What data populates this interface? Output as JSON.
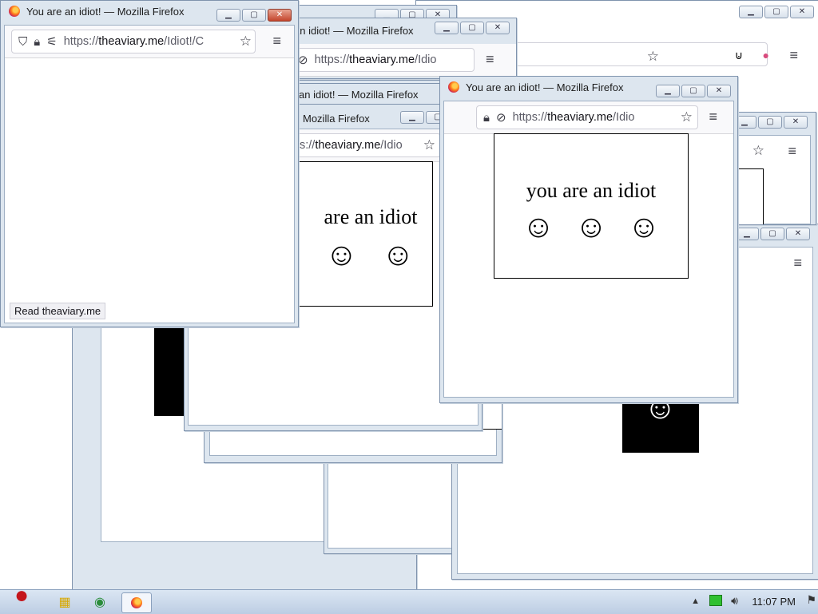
{
  "windows": {
    "title_main": "You are an idiot! — Mozilla Firefox",
    "title_partial_a": "an idiot! — Mozilla Firefox",
    "title_partial_b": "an idiot! — Mozilla Firefox",
    "title_partial_c": "Mozilla Firefox",
    "title_right": "You are an idiot! — Mozilla Firefox",
    "url_scheme": "https://",
    "url_host": "theaviary.me",
    "url_path_main": "/Idiot!/C",
    "url_path_trunc": "/Idio",
    "url_path_trunc2": "/Idiot",
    "url_scheme_partial": "s://",
    "status_text": "Read theaviary.me"
  },
  "page": {
    "idiot_text": "you are an idiot",
    "idiot_text_partial": "are an idiot",
    "smile": "☺"
  },
  "taskbar": {
    "clock": "11:07 PM"
  },
  "icons": [
    "shield-icon",
    "lock-icon",
    "tracking-icon",
    "star-icon",
    "menu-icon",
    "firefox-icon",
    "chrome-icon",
    "angry-bird-icon",
    "network-icon",
    "volume-icon",
    "flag-icon"
  ]
}
